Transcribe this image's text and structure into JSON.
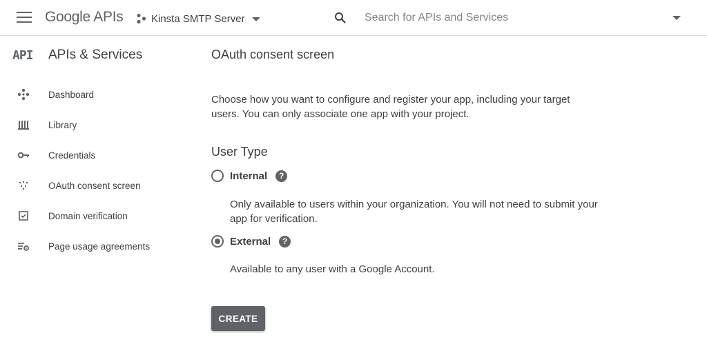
{
  "header": {
    "brand": "Google APIs",
    "project_name": "Kinsta SMTP Server",
    "search_placeholder": "Search for APIs and Services"
  },
  "sidebar": {
    "logo_text": "API",
    "title": "APIs & Services",
    "items": [
      {
        "label": "Dashboard",
        "icon": "dashboard-icon"
      },
      {
        "label": "Library",
        "icon": "library-icon"
      },
      {
        "label": "Credentials",
        "icon": "key-icon"
      },
      {
        "label": "OAuth consent screen",
        "icon": "consent-icon"
      },
      {
        "label": "Domain verification",
        "icon": "checkbox-icon"
      },
      {
        "label": "Page usage agreements",
        "icon": "settings-list-icon"
      }
    ]
  },
  "main": {
    "page_title": "OAuth consent screen",
    "intro": "Choose how you want to configure and register your app, including your target users. You can only associate one app with your project.",
    "section_title": "User Type",
    "options": [
      {
        "label": "Internal",
        "description": "Only available to users within your organization. You will not need to submit your app for verification.",
        "selected": false
      },
      {
        "label": "External",
        "description": "Available to any user with a Google Account.",
        "selected": true
      }
    ],
    "help_glyph": "?",
    "create_label": "CREATE"
  },
  "colors": {
    "icon_gray": "#5f6368",
    "text": "#3c4043",
    "divider": "#dadce0"
  }
}
